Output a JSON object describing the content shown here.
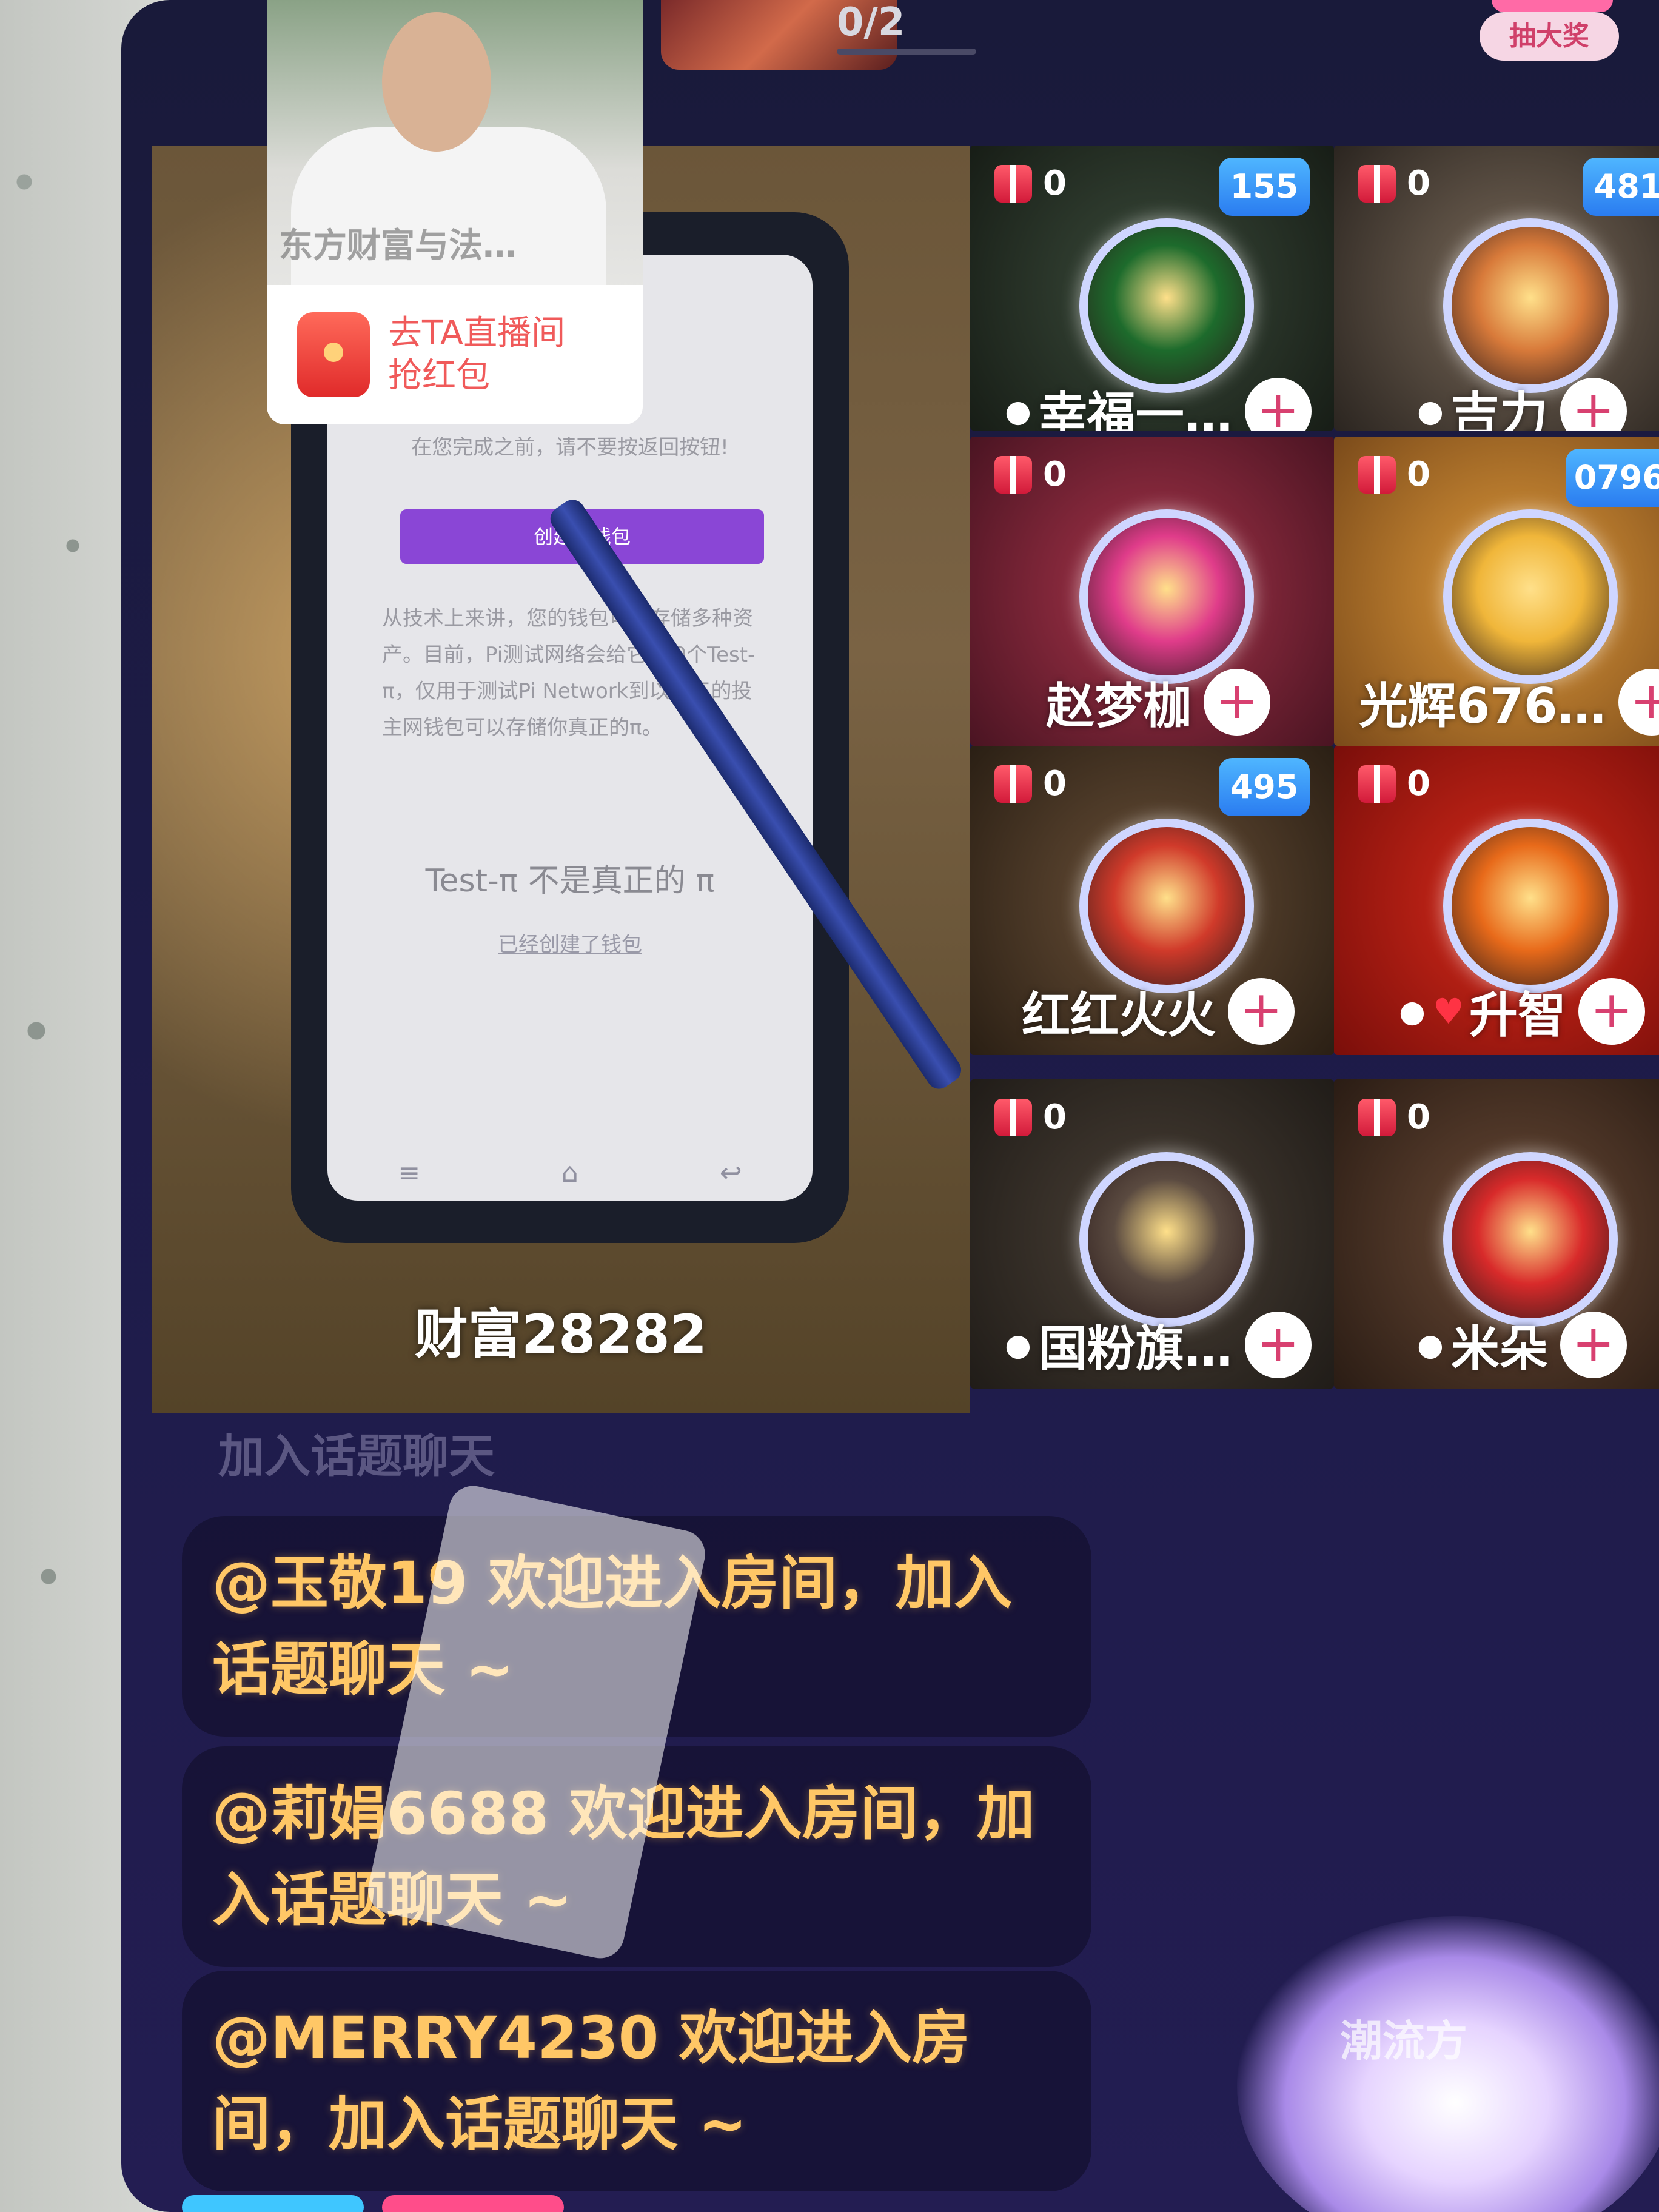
{
  "top_bar": {
    "progress": "0/2",
    "lottery_label": "抽大奖"
  },
  "pip": {
    "host_name": "东方财富与法…",
    "cta": "去TA直播间抢红包"
  },
  "host_video": {
    "name": "财富28282",
    "inner_screen": {
      "hint": "在您完成之前，请不要按返回按钮!",
      "create_wallet_button": "创建新钱包",
      "paragraph": "从技术上来讲，您的钱包可以存储多种资产。目前，Pi测试网络会给它100个Test-π，仅用于测试Pi Network到以第三的投主网钱包可以存储你真正的π。",
      "test_notice": "Test-π 不是真正的 π",
      "link": "已经创建了钱包"
    }
  },
  "seats": [
    {
      "gift": "0",
      "badge": "155",
      "name": "幸福一…",
      "mic": true,
      "heart": false,
      "avatar_color": "#1d6b2c"
    },
    {
      "gift": "0",
      "badge": "481",
      "name": "吉力",
      "mic": true,
      "heart": false,
      "avatar_color": "#d87a3a"
    },
    {
      "gift": "0",
      "badge": "",
      "name": "赵梦枷",
      "mic": false,
      "heart": false,
      "avatar_color": "#e03c8a"
    },
    {
      "gift": "0",
      "badge": "0796",
      "name": "光辉676…",
      "mic": false,
      "heart": false,
      "avatar_color": "#f0b63a"
    },
    {
      "gift": "0",
      "badge": "495",
      "name": "红红火火",
      "mic": false,
      "heart": false,
      "avatar_color": "#d03a2a"
    },
    {
      "gift": "0",
      "badge": "",
      "name": "升智",
      "mic": true,
      "heart": true,
      "avatar_color": "#e86a1a"
    },
    {
      "gift": "0",
      "badge": "",
      "name": "国粉旗…",
      "mic": true,
      "heart": false,
      "avatar_color": "#5a4a40"
    },
    {
      "gift": "0",
      "badge": "",
      "name": "米朵",
      "mic": true,
      "heart": false,
      "avatar_color": "#d82a2a"
    }
  ],
  "chat": {
    "faded_line": "加入话题聊天",
    "messages": [
      "@玉敬19 欢迎进入房间，加入话题聊天 ~",
      "@莉娟6688 欢迎进入房间，加入话题聊天 ~",
      "@MERRY4230 欢迎进入房间，加入话题聊天 ~"
    ]
  },
  "gift_animation_label": "潮流方"
}
